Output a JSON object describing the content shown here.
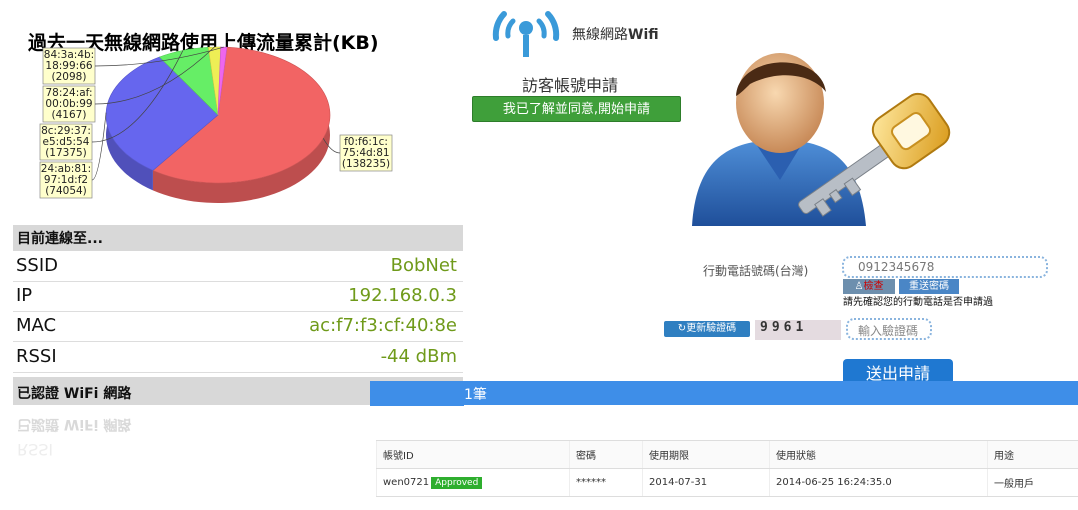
{
  "pie_chart": {
    "title": "過去一天無線網路使用上傳流量累計(KB)"
  },
  "chart_data": {
    "type": "pie",
    "title": "過去一天無線網路使用上傳流量累計(KB)",
    "categories": [
      "f0:f6:1c:75:4d:81",
      "24:ab:81:97:1d:f2",
      "8c:29:37:e5:d5:54",
      "78:24:af:00:0b:99",
      "84:3a:4b:18:99:66"
    ],
    "values": [
      138235,
      74054,
      17375,
      4167,
      2098
    ],
    "labels": [
      [
        "f0:f6:1c:",
        "75:4d:81",
        "(138235)"
      ],
      [
        "24:ab:81:",
        "97:1d:f2",
        "(74054)"
      ],
      [
        "8c:29:37:",
        "e5:d5:54",
        "(17375)"
      ],
      [
        "78:24:af:",
        "00:0b:99",
        "(4167)"
      ],
      [
        "84:3a:4b:",
        "18:99:66",
        "(2098)"
      ]
    ],
    "colors": [
      "#f26464",
      "#6666ee",
      "#66ee66",
      "#eeee55",
      "#ee66ee"
    ]
  },
  "connection": {
    "header": "目前連線至...",
    "rows": [
      {
        "key": "SSID",
        "value": "BobNet"
      },
      {
        "key": "IP",
        "value": "192.168.0.3"
      },
      {
        "key": "MAC",
        "value": "ac:f7:f3:cf:40:8e"
      },
      {
        "key": "RSSI",
        "value": "-44 dBm"
      }
    ]
  },
  "authenticated": {
    "header": "已認證 WiFi 網路",
    "reflection_text": "已認證 WiFi 網路",
    "reflection_text_2": "RSSI"
  },
  "application": {
    "brand_prefix": "無線網路",
    "brand_suffix": "Wifi",
    "title": "訪客帳號申請",
    "agree_button": "我已了解並同意,開始申請",
    "phone_label": "行動電話號碼(台灣)",
    "phone_placeholder": "0912345678",
    "check_button": "檢查",
    "resend_button": "重送密碼",
    "confirm_note": "請先確認您的行動電話是否申請過",
    "refresh_captcha": "更新驗證碼",
    "captcha_text": "9961",
    "captcha_placeholder": "輸入驗證碼",
    "submit_button": "送出申請",
    "result_count": "1筆"
  },
  "accounts_table": {
    "headers": [
      "帳號ID",
      "密碼",
      "使用期限",
      "使用狀態",
      "用途"
    ],
    "rows": [
      {
        "id": "wen0721",
        "badge": "Approved",
        "password": "******",
        "expiry": "2014-07-31",
        "status": "2014-06-25 16:24:35.0",
        "purpose": "一般用戶"
      }
    ]
  }
}
